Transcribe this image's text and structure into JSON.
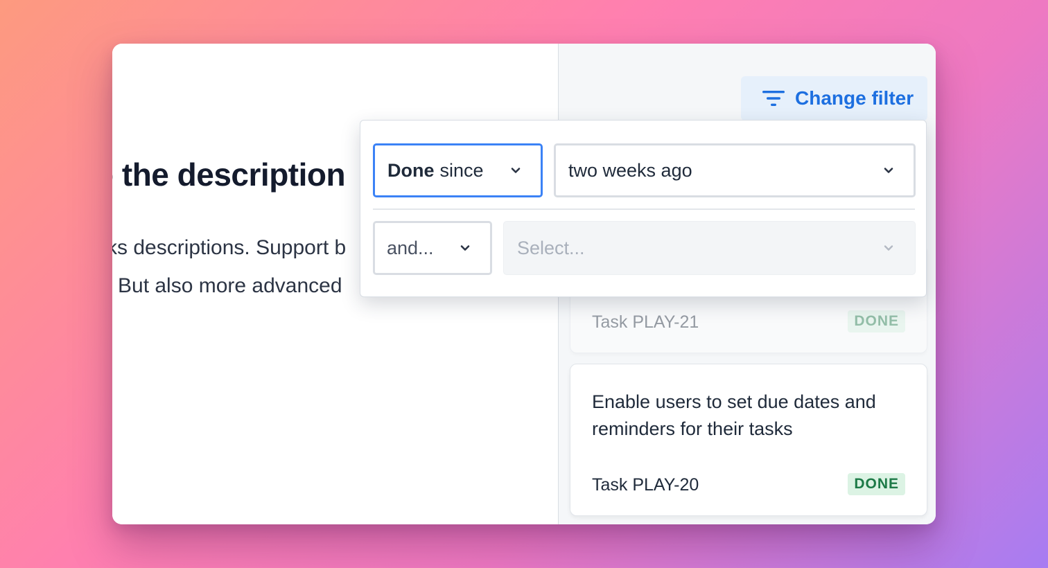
{
  "editor": {
    "heading": "o the description",
    "paragraph_line1": "ks descriptions. Support b",
    "paragraph_line2": "But also more advanced"
  },
  "filter_button": {
    "label": "Change filter",
    "icon": "filter-icon",
    "color": "#1d6fe0"
  },
  "filter_popover": {
    "row1": {
      "field": {
        "bold": "Done",
        "rest": "since"
      },
      "value": "two weeks ago"
    },
    "row2": {
      "connector": "and...",
      "placeholder": "Select..."
    }
  },
  "tasks": [
    {
      "id": "Task PLAY-21",
      "status": "DONE",
      "faded": true
    },
    {
      "title": "Enable users to set due dates and reminders for their tasks",
      "id": "Task PLAY-20",
      "status": "DONE"
    }
  ],
  "colors": {
    "accent": "#3b82f6",
    "done_badge_bg": "#dcf3e4",
    "done_badge_text": "#1d7a47"
  }
}
